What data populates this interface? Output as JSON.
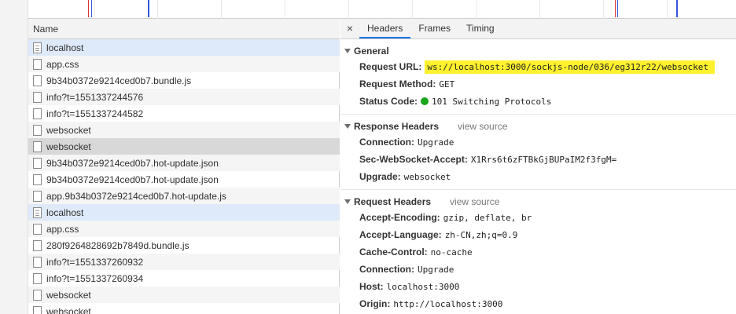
{
  "columns": {
    "name": "Name"
  },
  "requests": [
    {
      "name": "localhost",
      "icon": "document-icon"
    },
    {
      "name": "app.css",
      "icon": "file-icon"
    },
    {
      "name": "9b34b0372e9214ced0b7.bundle.js",
      "icon": "file-icon"
    },
    {
      "name": "info?t=1551337244576",
      "icon": "file-icon"
    },
    {
      "name": "info?t=1551337244582",
      "icon": "file-icon"
    },
    {
      "name": "websocket",
      "icon": "file-icon"
    },
    {
      "name": "websocket",
      "icon": "file-icon"
    },
    {
      "name": "9b34b0372e9214ced0b7.hot-update.json",
      "icon": "file-icon"
    },
    {
      "name": "9b34b0372e9214ced0b7.hot-update.json",
      "icon": "file-icon"
    },
    {
      "name": "app.9b34b0372e9214ced0b7.hot-update.js",
      "icon": "file-icon"
    },
    {
      "name": "localhost",
      "icon": "document-icon"
    },
    {
      "name": "app.css",
      "icon": "file-icon"
    },
    {
      "name": "280f9264828692b7849d.bundle.js",
      "icon": "file-icon"
    },
    {
      "name": "info?t=1551337260932",
      "icon": "file-icon"
    },
    {
      "name": "info?t=1551337260934",
      "icon": "file-icon"
    },
    {
      "name": "websocket",
      "icon": "file-icon"
    },
    {
      "name": "websocket",
      "icon": "file-icon"
    }
  ],
  "tabs": {
    "close": "×",
    "headers": "Headers",
    "frames": "Frames",
    "timing": "Timing"
  },
  "general": {
    "title": "General",
    "request_url_key": "Request URL:",
    "request_url": "ws://localhost:3000/sockjs-node/036/eg312r22/websocket",
    "request_method_key": "Request Method:",
    "request_method": "GET",
    "status_code_key": "Status Code:",
    "status_code": "101 Switching Protocols",
    "status_color": "#19a619"
  },
  "response_headers": {
    "title": "Response Headers",
    "view_source": "view source",
    "items": [
      {
        "key": "Connection:",
        "value": "Upgrade"
      },
      {
        "key": "Sec-WebSocket-Accept:",
        "value": "X1Rrs6t6zFTBkGjBUPaIM2f3fgM="
      },
      {
        "key": "Upgrade:",
        "value": "websocket"
      }
    ]
  },
  "request_headers": {
    "title": "Request Headers",
    "view_source": "view source",
    "items": [
      {
        "key": "Accept-Encoding:",
        "value": "gzip, deflate, br"
      },
      {
        "key": "Accept-Language:",
        "value": "zh-CN,zh;q=0.9"
      },
      {
        "key": "Cache-Control:",
        "value": "no-cache"
      },
      {
        "key": "Connection:",
        "value": "Upgrade"
      },
      {
        "key": "Host:",
        "value": "localhost:3000"
      },
      {
        "key": "Origin:",
        "value": "http://localhost:3000"
      }
    ]
  },
  "colors": {
    "highlight": "#fff12e",
    "active_tab": "#1a73e8",
    "row_highlight": "#deeafa",
    "row_selected": "#d8d8d8"
  }
}
